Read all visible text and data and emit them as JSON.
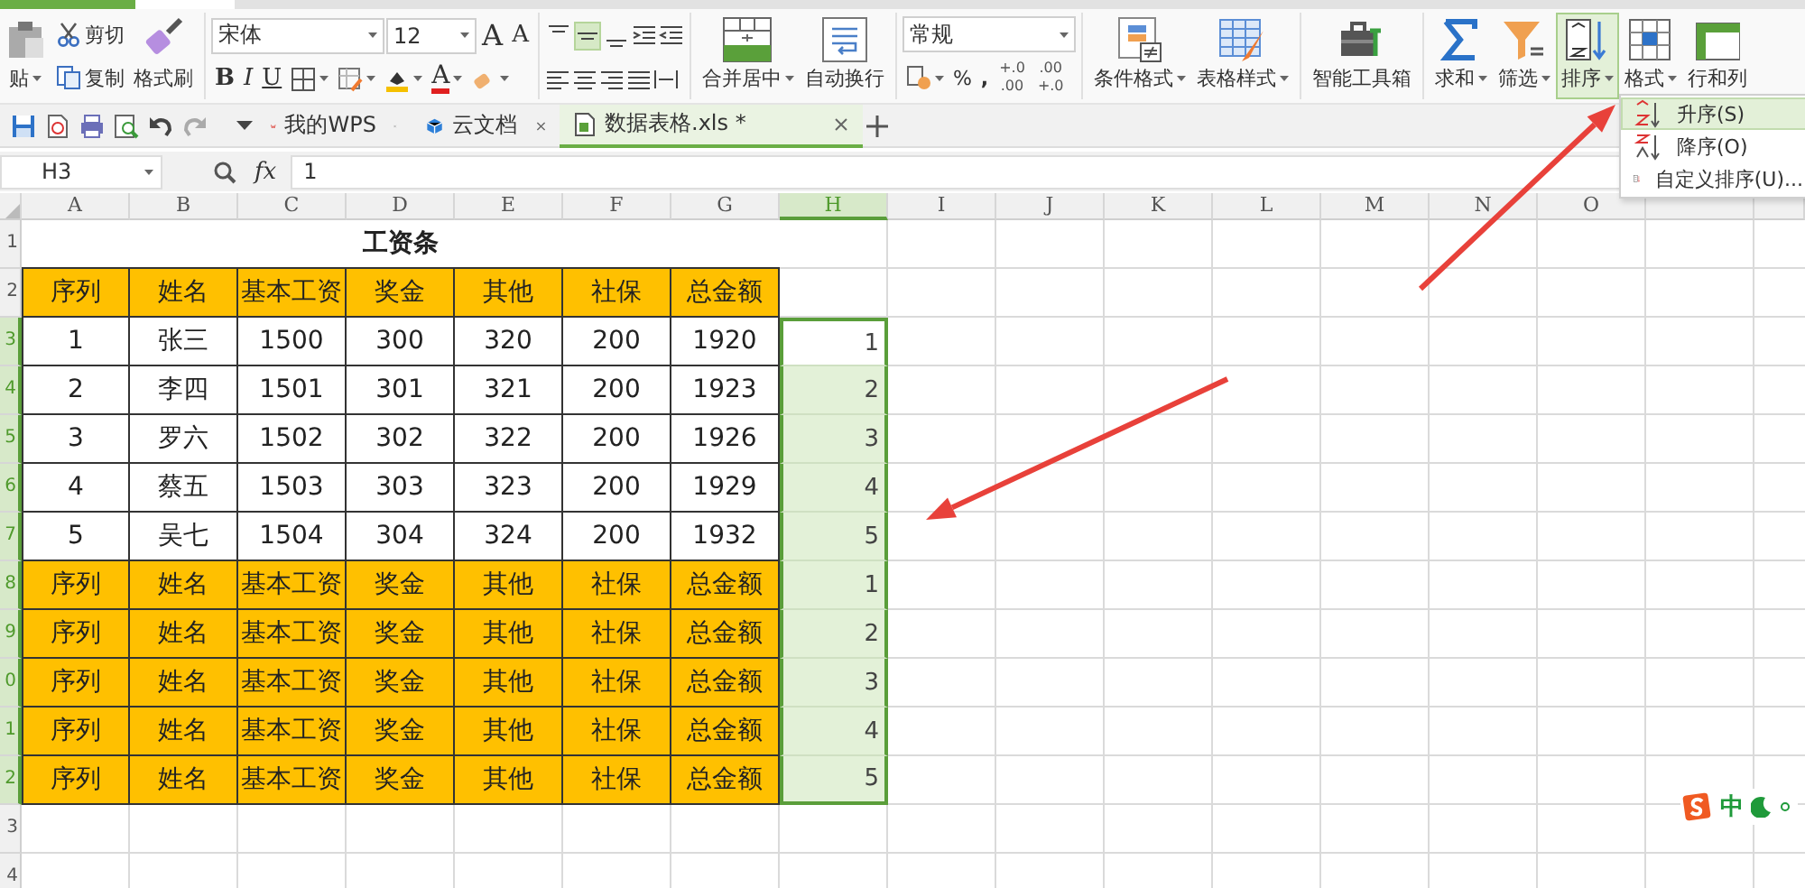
{
  "ribbon": {
    "paste": "贴",
    "clipboard": [
      {
        "label": "剪切",
        "kind": "cut"
      },
      {
        "label": "复制",
        "kind": "copy"
      }
    ],
    "format_painter": "格式刷",
    "font_name": "宋体",
    "font_size": "12",
    "size_buttons": [
      {
        "letter": "A",
        "kind": "grow"
      },
      {
        "letter": "A",
        "kind": "shrink"
      }
    ],
    "style_buttons": [
      {
        "label": "B",
        "kind": "bold"
      },
      {
        "label": "I",
        "kind": "italic"
      },
      {
        "label": "U",
        "kind": "underline"
      }
    ],
    "font_color": "A",
    "align_top": [
      {
        "selected": false
      },
      {
        "selected": true
      },
      {
        "selected": false
      }
    ],
    "merge_buttons": [
      {
        "label": "合并居中",
        "kind": "merge",
        "dropdown": true
      },
      {
        "label": "自动换行",
        "kind": "wrap",
        "dropdown": false
      }
    ],
    "number_format": "常规",
    "percent": "%",
    "thousands": ",",
    "decimal_buttons": [
      {
        "top": "+.0",
        "bottom": ".00"
      },
      {
        "top": ".00",
        "bottom": "+.0"
      }
    ],
    "format_buttons": [
      {
        "label": "条件格式",
        "kind": "conditional",
        "dropdown": true
      },
      {
        "label": "表格样式",
        "kind": "tablestyle",
        "dropdown": true
      }
    ],
    "toolbox": {
      "label": "智能工具箱",
      "kind": "toolbox",
      "dropdown": false
    },
    "data_buttons": [
      {
        "label": "求和",
        "kind": "sum",
        "dropdown": true,
        "selected": false
      },
      {
        "label": "筛选",
        "kind": "filter",
        "dropdown": true,
        "selected": false
      },
      {
        "label": "排序",
        "kind": "sort",
        "dropdown": true,
        "selected": true
      },
      {
        "label": "格式",
        "kind": "format",
        "dropdown": true,
        "selected": false
      },
      {
        "label": "行和列",
        "kind": "rowcol",
        "dropdown": false,
        "selected": false
      }
    ]
  },
  "doc_tabs": [
    {
      "label": "我的WPS",
      "kind": "wps",
      "selected": false
    },
    {
      "label": "云文档",
      "kind": "cloud",
      "selected": false
    },
    {
      "label": "数据表格.xls *",
      "kind": "sheet",
      "selected": true
    }
  ],
  "formula_bar": {
    "name_box": "H3",
    "fx": "fx",
    "value": "1"
  },
  "sort_menu": [
    {
      "label": "升序(S)",
      "kind": "asc",
      "selected": true
    },
    {
      "label": "降序(O)",
      "kind": "desc",
      "selected": false
    },
    {
      "label": "自定义排序(U)...",
      "kind": "custom",
      "selected": false
    }
  ],
  "sheet": {
    "columns": [
      {
        "label": "A",
        "selected": false
      },
      {
        "label": "B",
        "selected": false
      },
      {
        "label": "C",
        "selected": false
      },
      {
        "label": "D",
        "selected": false
      },
      {
        "label": "E",
        "selected": false
      },
      {
        "label": "F",
        "selected": false
      },
      {
        "label": "G",
        "selected": false
      },
      {
        "label": "H",
        "selected": true
      },
      {
        "label": "I",
        "selected": false
      },
      {
        "label": "J",
        "selected": false
      },
      {
        "label": "K",
        "selected": false
      },
      {
        "label": "L",
        "selected": false
      },
      {
        "label": "M",
        "selected": false
      },
      {
        "label": "N",
        "selected": false
      },
      {
        "label": "O",
        "selected": false
      }
    ],
    "rows": [
      {
        "header": "1",
        "selected": false,
        "kind": "title",
        "cells": [
          "工资条"
        ]
      },
      {
        "header": "2",
        "selected": false,
        "kind": "header",
        "cells": [
          "序列",
          "姓名",
          "基本工资",
          "奖金",
          "其他",
          "社保",
          "总金额"
        ]
      },
      {
        "header": "3",
        "selected": true,
        "kind": "data",
        "cells": [
          "1",
          "张三",
          "1500",
          "300",
          "320",
          "200",
          "1920"
        ],
        "h": "1",
        "active": true
      },
      {
        "header": "4",
        "selected": true,
        "kind": "data",
        "cells": [
          "2",
          "李四",
          "1501",
          "301",
          "321",
          "200",
          "1923"
        ],
        "h": "2",
        "active": false
      },
      {
        "header": "5",
        "selected": true,
        "kind": "data",
        "cells": [
          "3",
          "罗六",
          "1502",
          "302",
          "322",
          "200",
          "1926"
        ],
        "h": "3",
        "active": false
      },
      {
        "header": "6",
        "selected": true,
        "kind": "data",
        "cells": [
          "4",
          "蔡五",
          "1503",
          "303",
          "323",
          "200",
          "1929"
        ],
        "h": "4",
        "active": false
      },
      {
        "header": "7",
        "selected": true,
        "kind": "data",
        "cells": [
          "5",
          "吴七",
          "1504",
          "304",
          "324",
          "200",
          "1932"
        ],
        "h": "5",
        "active": false
      },
      {
        "header": "8",
        "selected": true,
        "kind": "header",
        "cells": [
          "序列",
          "姓名",
          "基本工资",
          "奖金",
          "其他",
          "社保",
          "总金额"
        ],
        "h": "1",
        "active": false
      },
      {
        "header": "9",
        "selected": true,
        "kind": "header",
        "cells": [
          "序列",
          "姓名",
          "基本工资",
          "奖金",
          "其他",
          "社保",
          "总金额"
        ],
        "h": "2",
        "active": false
      },
      {
        "header": "0",
        "selected": true,
        "kind": "header",
        "cells": [
          "序列",
          "姓名",
          "基本工资",
          "奖金",
          "其他",
          "社保",
          "总金额"
        ],
        "h": "3",
        "active": false
      },
      {
        "header": "1",
        "selected": true,
        "kind": "header",
        "cells": [
          "序列",
          "姓名",
          "基本工资",
          "奖金",
          "其他",
          "社保",
          "总金额"
        ],
        "h": "4",
        "active": false
      },
      {
        "header": "2",
        "selected": true,
        "kind": "header",
        "cells": [
          "序列",
          "姓名",
          "基本工资",
          "奖金",
          "其他",
          "社保",
          "总金额"
        ],
        "h": "5",
        "active": false
      },
      {
        "header": "3",
        "selected": false,
        "kind": "empty"
      },
      {
        "header": "4",
        "selected": false,
        "kind": "empty"
      }
    ]
  },
  "ime": {
    "mode": "中"
  }
}
